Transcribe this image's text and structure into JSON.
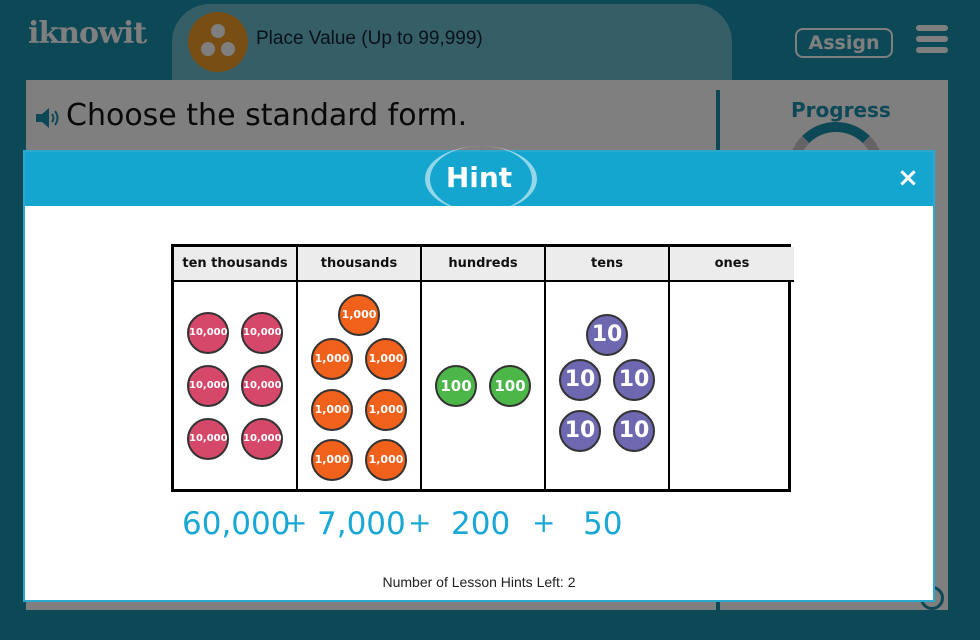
{
  "app": {
    "logo": "iknowit"
  },
  "lesson": {
    "title": "Place Value (Up to 99,999)"
  },
  "header": {
    "assign_label": "Assign"
  },
  "question": {
    "text": "Choose the standard form."
  },
  "progress": {
    "label": "Progress"
  },
  "hint": {
    "title": "Hint",
    "close_label": "×",
    "columns": [
      {
        "label": "ten thousands",
        "chip_label": "10,000",
        "count": 6
      },
      {
        "label": "thousands",
        "chip_label": "1,000",
        "count": 7
      },
      {
        "label": "hundreds",
        "chip_label": "100",
        "count": 2
      },
      {
        "label": "tens",
        "chip_label": "10",
        "count": 5
      },
      {
        "label": "ones",
        "chip_label": "",
        "count": 0
      }
    ],
    "addends": [
      "60,000",
      "7,000",
      "200",
      "50"
    ],
    "plus": "+",
    "hints_left": "Number of Lesson Hints Left: 2"
  },
  "colors": {
    "accent": "#1b90ad",
    "hint_header": "#15a6cf",
    "addend_text": "#19a8d6"
  }
}
